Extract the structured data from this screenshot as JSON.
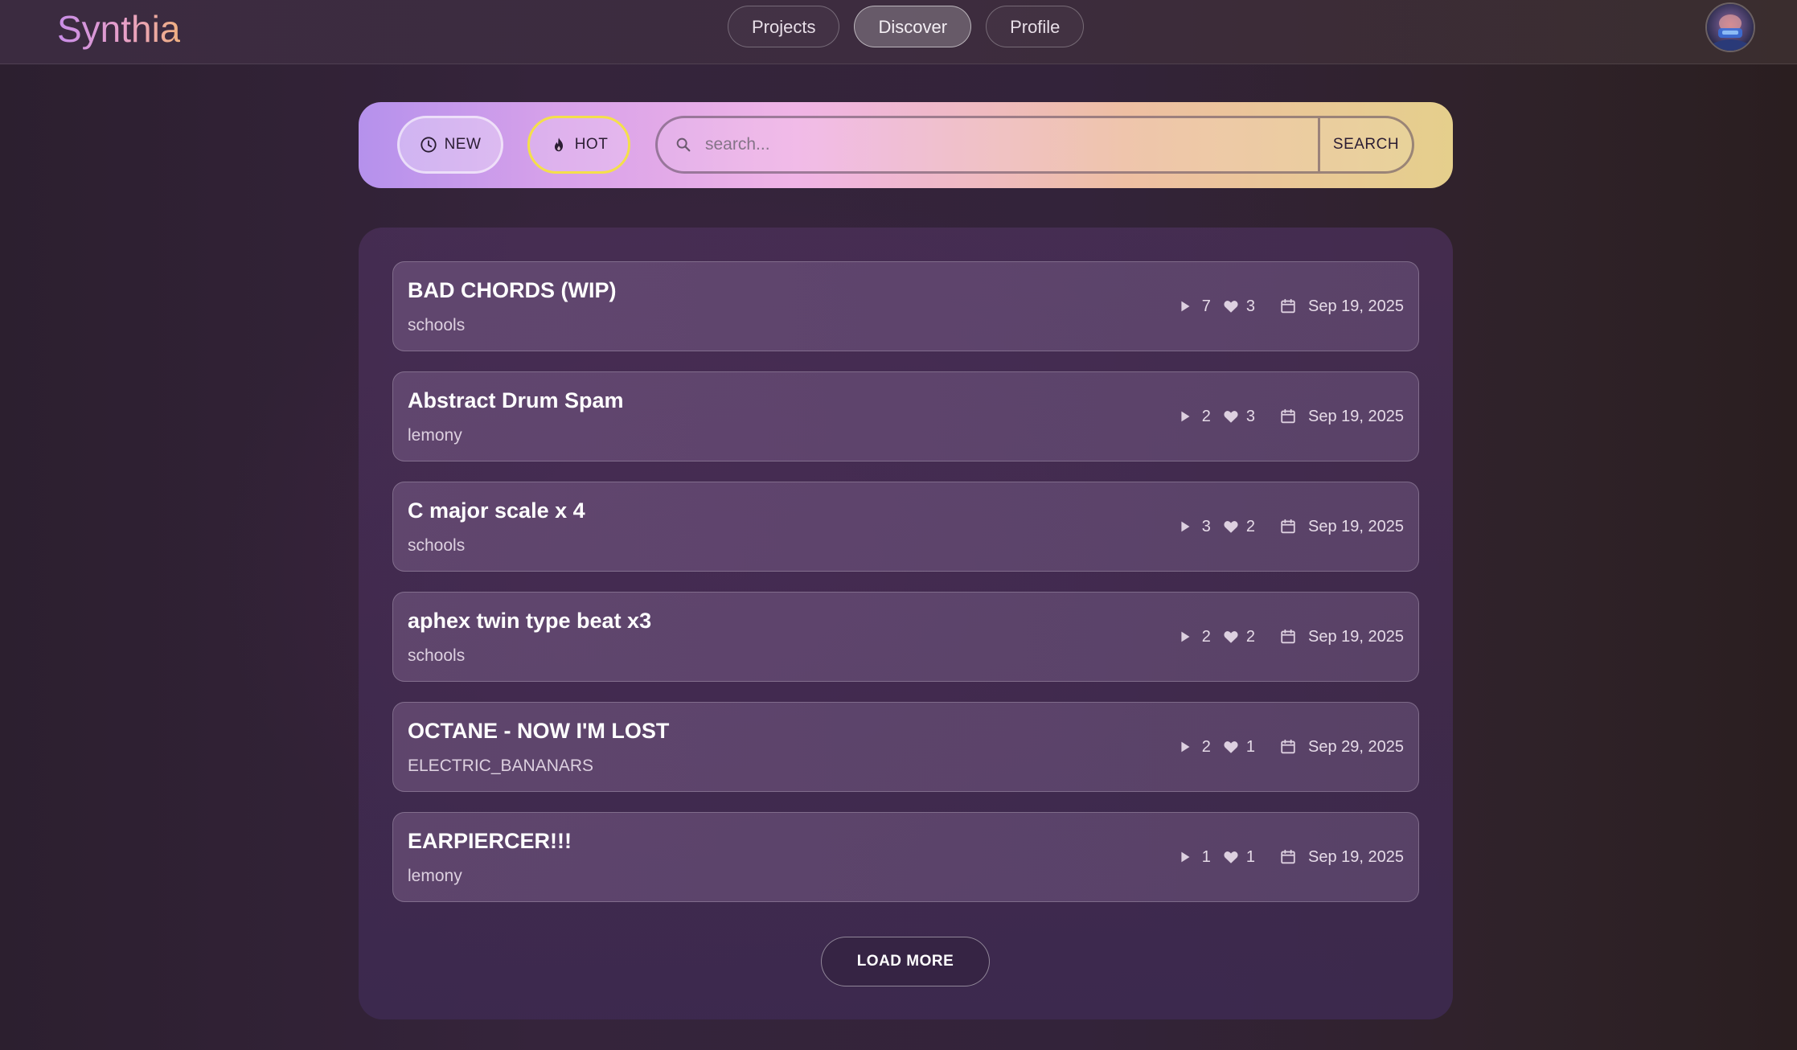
{
  "app": {
    "name": "Synthia"
  },
  "nav": {
    "tabs": [
      {
        "label": "Projects",
        "active": false
      },
      {
        "label": "Discover",
        "active": true
      },
      {
        "label": "Profile",
        "active": false
      }
    ]
  },
  "filters": {
    "new_label": "NEW",
    "hot_label": "HOT",
    "active": "HOT",
    "search_placeholder": "search...",
    "search_value": "",
    "search_button": "SEARCH"
  },
  "tracks": [
    {
      "title": "BAD CHORDS (WIP)",
      "author": "schools",
      "plays": "7",
      "likes": "3",
      "date": "Sep 19, 2025"
    },
    {
      "title": "Abstract Drum Spam",
      "author": "lemony",
      "plays": "2",
      "likes": "3",
      "date": "Sep 19, 2025"
    },
    {
      "title": "C major scale x 4",
      "author": "schools",
      "plays": "3",
      "likes": "2",
      "date": "Sep 19, 2025"
    },
    {
      "title": "aphex twin type beat x3",
      "author": "schools",
      "plays": "2",
      "likes": "2",
      "date": "Sep 19, 2025"
    },
    {
      "title": "OCTANE - NOW I'M LOST",
      "author": "ELECTRIC_BANANARS",
      "plays": "2",
      "likes": "1",
      "date": "Sep 29, 2025"
    },
    {
      "title": "EARPIERCER!!!",
      "author": "lemony",
      "plays": "1",
      "likes": "1",
      "date": "Sep 19, 2025"
    }
  ],
  "load_more_label": "LOAD MORE",
  "icons": {
    "new": "clock-icon",
    "hot": "flame-icon",
    "search": "search-icon",
    "plays": "play-icon",
    "likes": "heart-icon",
    "date": "calendar-icon",
    "avatar": "avatar"
  },
  "colors": {
    "logo_gradient_start": "#c88de8",
    "logo_gradient_end": "#f0b080",
    "hot_border": "#f4e04a",
    "filter_gradient_start": "#b591ec",
    "filter_gradient_end": "#e5cf8c"
  }
}
